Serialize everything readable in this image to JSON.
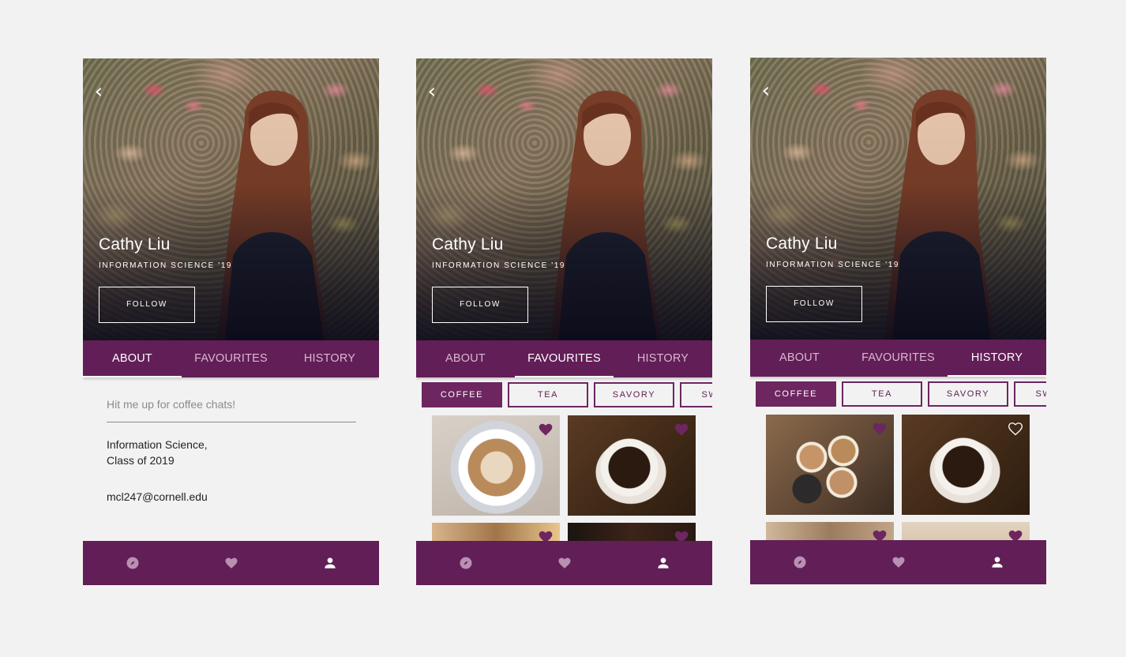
{
  "screens": [
    {
      "hero": {
        "back_icon": "chevron-left-icon",
        "name": "Cathy Liu",
        "major": "INFORMATION SCIENCE '19",
        "follow_label": "FOLLOW"
      },
      "tabs": [
        {
          "label": "ABOUT",
          "active": true
        },
        {
          "label": "FAVOURITES",
          "active": false
        },
        {
          "label": "HISTORY",
          "active": false
        }
      ],
      "about": {
        "bio": "Hit me up for coffee chats!",
        "program_line1": "Information Science,",
        "program_line2": "Class of 2019",
        "email": "mcl247@cornell.edu"
      },
      "nav": [
        {
          "icon": "compass-icon",
          "active": false
        },
        {
          "icon": "heart-icon",
          "active": false
        },
        {
          "icon": "person-icon",
          "active": true
        }
      ]
    },
    {
      "hero": {
        "back_icon": "chevron-left-icon",
        "name": "Cathy Liu",
        "major": "INFORMATION SCIENCE '19",
        "follow_label": "FOLLOW"
      },
      "tabs": [
        {
          "label": "ABOUT",
          "active": false
        },
        {
          "label": "FAVOURITES",
          "active": true
        },
        {
          "label": "HISTORY",
          "active": false
        }
      ],
      "chips": [
        {
          "label": "COFFEE",
          "active": true
        },
        {
          "label": "TEA",
          "active": false
        },
        {
          "label": "SAVORY",
          "active": false
        },
        {
          "label": "SWEET",
          "active": false
        }
      ],
      "tiles": [
        {
          "image": "latte art coffee",
          "favorited": true
        },
        {
          "image": "black coffee cup",
          "favorited": true
        },
        {
          "image": "cafe interior",
          "favorited": true
        },
        {
          "image": "dark cafe",
          "favorited": true
        }
      ],
      "nav": [
        {
          "icon": "compass-icon",
          "active": false
        },
        {
          "icon": "heart-icon",
          "active": false
        },
        {
          "icon": "person-icon",
          "active": true
        }
      ]
    },
    {
      "hero": {
        "back_icon": "chevron-left-icon",
        "name": "Cathy Liu",
        "major": "INFORMATION SCIENCE '19",
        "follow_label": "FOLLOW"
      },
      "tabs": [
        {
          "label": "ABOUT",
          "active": false
        },
        {
          "label": "FAVOURITES",
          "active": false
        },
        {
          "label": "HISTORY",
          "active": true
        }
      ],
      "chips": [
        {
          "label": "COFFEE",
          "active": true
        },
        {
          "label": "TEA",
          "active": false
        },
        {
          "label": "SAVORY",
          "active": false
        },
        {
          "label": "SWEET",
          "active": false
        }
      ],
      "tiles": [
        {
          "image": "friends cheers latte",
          "favorited": true
        },
        {
          "image": "black coffee cup",
          "favorited": false
        },
        {
          "image": "latte cups",
          "favorited": true
        },
        {
          "image": "wooden table",
          "favorited": true
        }
      ],
      "nav": [
        {
          "icon": "compass-icon",
          "active": false
        },
        {
          "icon": "heart-icon",
          "active": false
        },
        {
          "icon": "person-icon",
          "active": true
        }
      ]
    }
  ],
  "colors": {
    "brand_purple": "#621e56",
    "chip_purple": "#6d2660",
    "tab_inactive": "#d8b8d2",
    "nav_inactive": "#b990b2",
    "background": "#f2f2f3"
  }
}
